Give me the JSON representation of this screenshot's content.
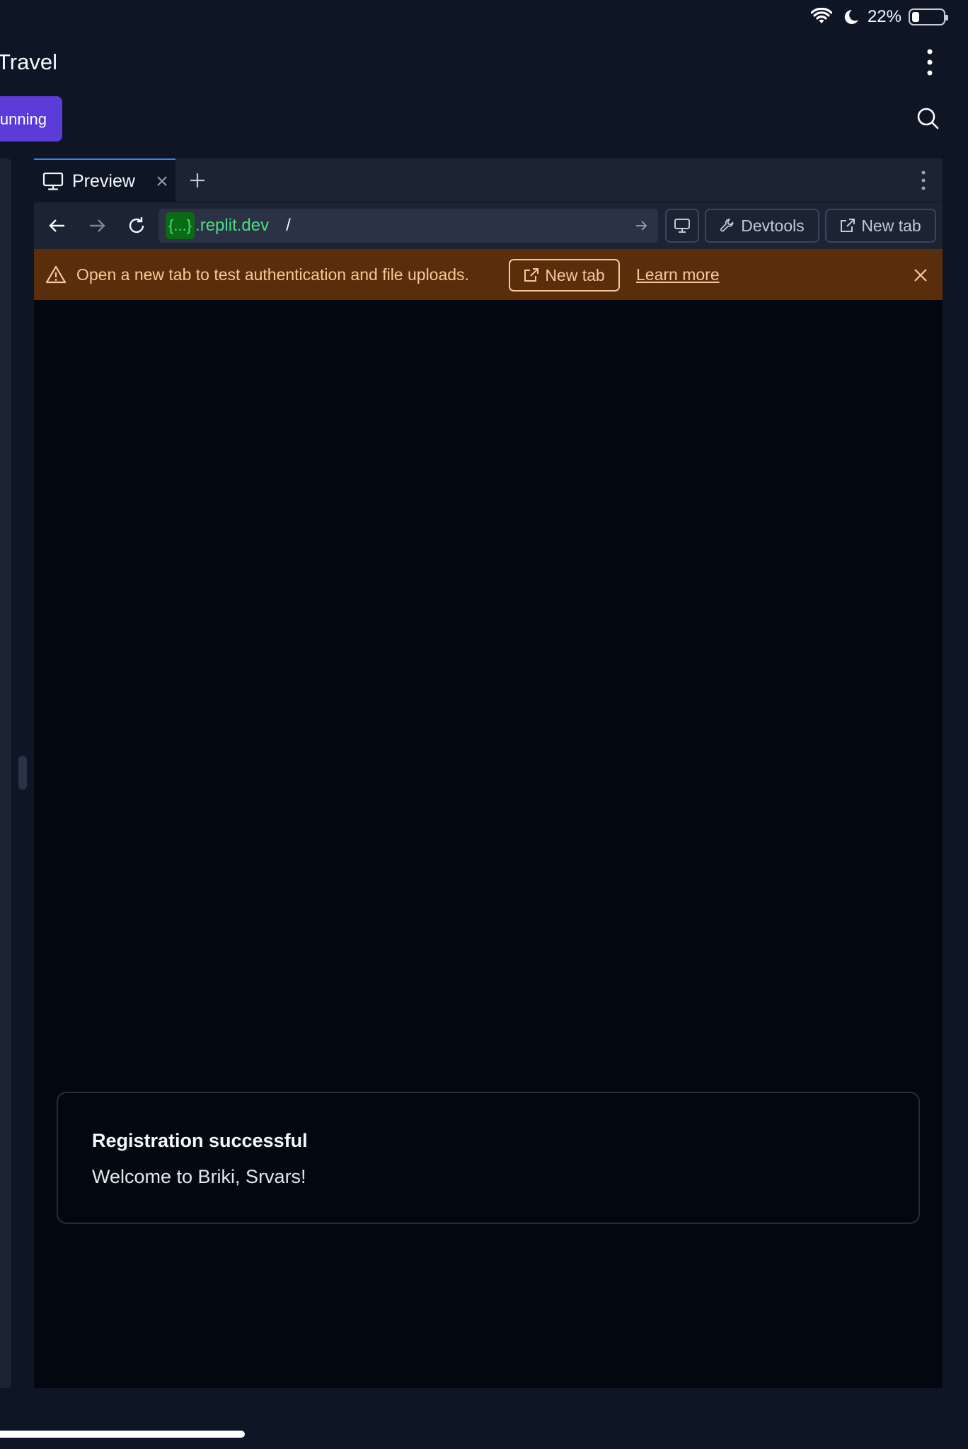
{
  "status_bar": {
    "battery_percent": "22%",
    "battery_level": 0.22
  },
  "header": {
    "title": "Travel",
    "run_button_label": "Running"
  },
  "workspace": {
    "tabs": [
      {
        "label": "Preview",
        "active": true
      }
    ],
    "navbar": {
      "url_chip": "{...}",
      "url_host": ".replit.dev",
      "url_path": "/",
      "devtools_label": "Devtools",
      "new_tab_label": "New tab"
    },
    "banner": {
      "message": "Open a new tab to test authentication and file uploads.",
      "button_label": "New tab",
      "link_label": "Learn more",
      "background": "#5a2e0b",
      "text_color": "#f8c79a"
    },
    "toast": {
      "title": "Registration successful",
      "description": "Welcome to Briki, Srvars!"
    }
  },
  "colors": {
    "background": "#0e1525",
    "surface": "#1c2333",
    "accent": "#5b3cd8",
    "url_green": "#4ade80"
  },
  "icons": [
    "wifi-icon",
    "moon-icon",
    "battery-icon",
    "kebab-menu-icon",
    "search-icon",
    "monitor-icon",
    "close-icon",
    "plus-icon",
    "back-arrow-icon",
    "forward-arrow-icon",
    "reload-icon",
    "go-arrow-icon",
    "devices-icon",
    "wrench-icon",
    "external-link-icon",
    "warning-icon"
  ]
}
